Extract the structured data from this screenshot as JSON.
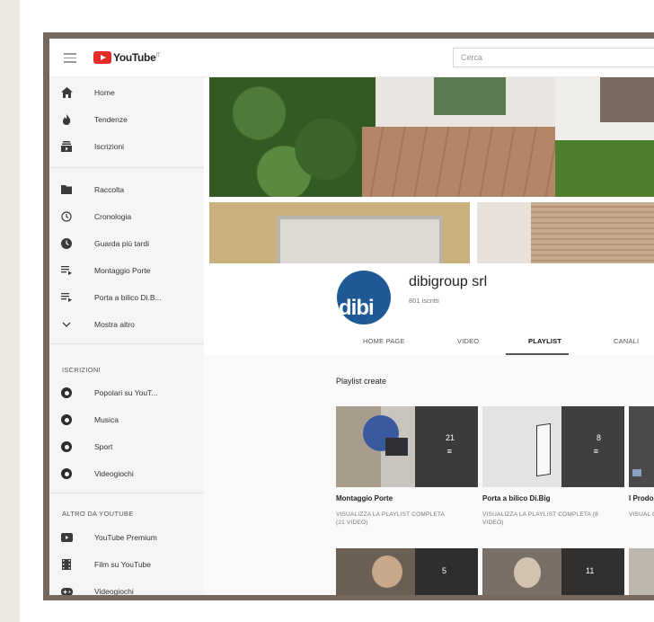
{
  "topbar": {
    "logo_text": "YouTube",
    "logo_sup": "IT",
    "search_placeholder": "Cerca"
  },
  "sidebar": {
    "main": [
      {
        "label": "Home",
        "icon": "home-icon"
      },
      {
        "label": "Tendenze",
        "icon": "flame-icon"
      },
      {
        "label": "Iscrizioni",
        "icon": "subscriptions-icon"
      }
    ],
    "library": [
      {
        "label": "Raccolta",
        "icon": "folder-icon"
      },
      {
        "label": "Cronologia",
        "icon": "history-icon"
      },
      {
        "label": "Guarda più tardi",
        "icon": "clock-icon"
      },
      {
        "label": "Montaggio Porte",
        "icon": "playlist-icon"
      },
      {
        "label": "Porta a bilico Di.B...",
        "icon": "playlist-icon"
      },
      {
        "label": "Mostra altro",
        "icon": "chevron-down-icon"
      }
    ],
    "subscriptions_heading": "ISCRIZIONI",
    "subscriptions": [
      {
        "label": "Popolari su YouT...",
        "icon": "channel-icon"
      },
      {
        "label": "Musica",
        "icon": "channel-icon"
      },
      {
        "label": "Sport",
        "icon": "channel-icon"
      },
      {
        "label": "Videogiochi",
        "icon": "channel-icon"
      }
    ],
    "more_heading": "ALTRO DA YOUTUBE",
    "more": [
      {
        "label": "YouTube Premium",
        "icon": "youtube-icon"
      },
      {
        "label": "Film su YouTube",
        "icon": "film-icon"
      },
      {
        "label": "Videogiochi",
        "icon": "gamepad-icon"
      }
    ]
  },
  "channel": {
    "avatar_text": "dibi",
    "name": "dibigroup srl",
    "subscribers": "801 iscritti",
    "tabs": [
      "HOME PAGE",
      "VIDEO",
      "PLAYLIST",
      "CANALI"
    ],
    "active_tab": "PLAYLIST"
  },
  "content": {
    "section_title": "Playlist create",
    "playlists": [
      {
        "title": "Montaggio Porte",
        "count": "21",
        "link": "VISUALIZZA LA PLAYLIST COMPLETA (21 VIDEO)"
      },
      {
        "title": "Porta a bilico Di.Big",
        "count": "8",
        "link": "VISUALIZZA LA PLAYLIST COMPLETA (8 VIDEO)"
      },
      {
        "title": "I Prodo",
        "count": "",
        "link": "VISUAL COMPLE"
      }
    ],
    "row2_counts": [
      "5",
      "11"
    ]
  },
  "colors": {
    "youtube_red": "#e52d27",
    "frame": "#77685d",
    "avatar_blue": "#1f5a96"
  }
}
